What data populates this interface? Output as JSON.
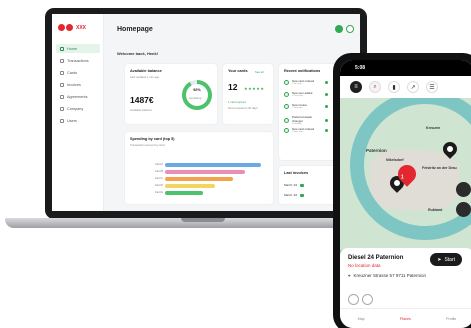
{
  "app": {
    "logo_text": "XXX",
    "page_title": "Homepage",
    "welcome": "Welcome back, Henk!"
  },
  "sidebar": {
    "items": [
      {
        "label": "Home"
      },
      {
        "label": "Transactions"
      },
      {
        "label": "Cards"
      },
      {
        "label": "Invoices"
      },
      {
        "label": "Agreements"
      },
      {
        "label": "Company"
      },
      {
        "label": "Users"
      }
    ]
  },
  "balance": {
    "title": "Available balance",
    "sub": "Last updated 1 min ago",
    "amount": "1487€",
    "sub2": "Available balance",
    "percent": "92%",
    "percent_label": "remaining",
    "percent_value": 0.92
  },
  "cards": {
    "title": "Your cards",
    "link": "See all",
    "count": "12",
    "stars": "★★★★★",
    "link2": "1 card expired",
    "sub": "Next renewal in 30 days"
  },
  "notifications": {
    "title": "Recent notifications",
    "items": [
      {
        "text": "New card ordered",
        "time": "2 min ago"
      },
      {
        "text": "New user added",
        "time": "12 min ago"
      },
      {
        "text": "New invoice",
        "time": "1 hour ago"
      },
      {
        "text": "Preferred dealer changed",
        "time": "Yesterday"
      },
      {
        "text": "New card ordered",
        "time": "2 days ago"
      }
    ]
  },
  "spending": {
    "title": "Spending by card (top 5)",
    "sub": "Transaction amount by card",
    "labels": [
      "Card A",
      "Card B",
      "Card C",
      "Card D",
      "Card E"
    ]
  },
  "invoices": {
    "title": "Last invoices",
    "link": "See all",
    "rows": [
      {
        "label": "March '24"
      },
      {
        "label": "March '24"
      }
    ]
  },
  "phone": {
    "time": "5:08",
    "places": [
      "Paternion",
      "Feistritz an der Drau",
      "Nikelsdorf",
      "Kreuzen",
      "Rubland",
      "Feistritz an der Drau"
    ],
    "station_name": "Diesel 24 Paternion",
    "warning": "No location data",
    "address": "Kreuzner Strasse 57 9711 Paternion",
    "start": "Start",
    "pin_badge": "1",
    "nav": [
      "Map",
      "Places",
      "Profile"
    ]
  },
  "colors": {
    "accent": "#34a853",
    "brand_red": "#e3262f",
    "dark": "#1b1b1b"
  }
}
